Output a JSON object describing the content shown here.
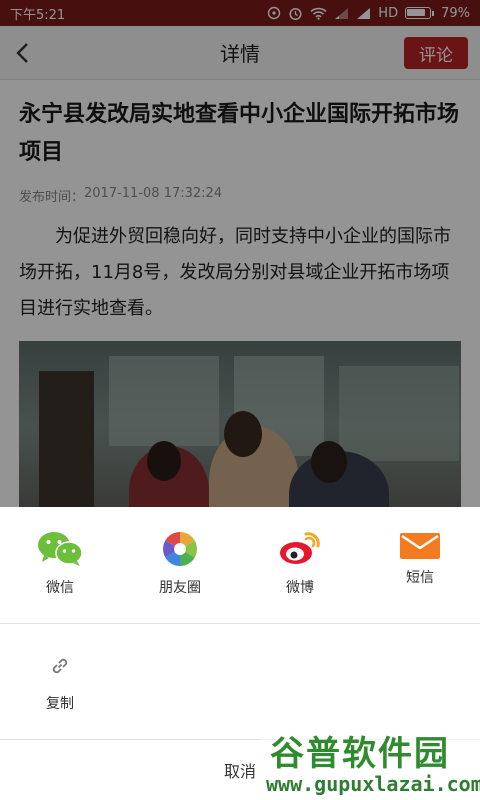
{
  "status_bar": {
    "time": "下午5:21",
    "network": "HD",
    "battery": "79%"
  },
  "header": {
    "title": "详情",
    "comment_label": "评论"
  },
  "article": {
    "title": "永宁县发改局实地查看中小企业国际开拓市场项目",
    "published_label": "发布时间：",
    "published_time": "2017-11-08 17:32:24",
    "body": "为促进外贸回稳向好，同时支持中小企业的国际市场开拓，11月8号，发改局分别对县域企业开拓市场项目进行实地查看。"
  },
  "share_sheet": {
    "items": [
      {
        "label": "微信",
        "icon": "wechat-icon",
        "color": "#6bbf3b"
      },
      {
        "label": "朋友圈",
        "icon": "moments-icon",
        "color": "#e8a73a"
      },
      {
        "label": "微博",
        "icon": "weibo-icon",
        "color": "#e6162d"
      },
      {
        "label": "短信",
        "icon": "sms-icon",
        "color": "#f47b20"
      }
    ],
    "copy_label": "复制",
    "cancel_label": "取消"
  },
  "watermark": {
    "title": "谷普软件园",
    "url": "www.gupuxlazai.com"
  }
}
